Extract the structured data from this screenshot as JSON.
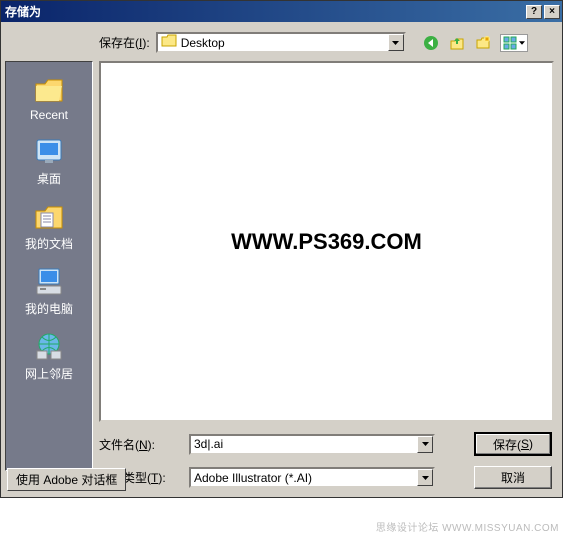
{
  "titlebar": {
    "title": "存储为",
    "help": "?",
    "close": "×"
  },
  "top": {
    "save_in_label": "保存在(I):",
    "location": "Desktop"
  },
  "toolbar": {
    "back": "back-icon",
    "up": "up-icon",
    "new": "new-folder-icon",
    "view": "view-menu-icon"
  },
  "sidebar": {
    "items": [
      {
        "label": "Recent",
        "icon": "folder"
      },
      {
        "label": "桌面",
        "icon": "desktop"
      },
      {
        "label": "我的文档",
        "icon": "documents"
      },
      {
        "label": "我的电脑",
        "icon": "computer"
      },
      {
        "label": "网上邻居",
        "icon": "network"
      }
    ]
  },
  "main": {
    "watermark": "WWW.PS369.COM"
  },
  "fields": {
    "filename_label": "文件名(N):",
    "filename_value": "3d|.ai",
    "type_label": "保存类型(T):",
    "type_value": "Adobe Illustrator (*.AI)"
  },
  "buttons": {
    "save": "保存(S)",
    "cancel": "取消"
  },
  "bottom": {
    "adobe_dialog": "使用 Adobe 对话框"
  },
  "footer": {
    "credit_left": "思缘设计论坛",
    "credit_right": "WWW.MISSYUAN.COM"
  }
}
